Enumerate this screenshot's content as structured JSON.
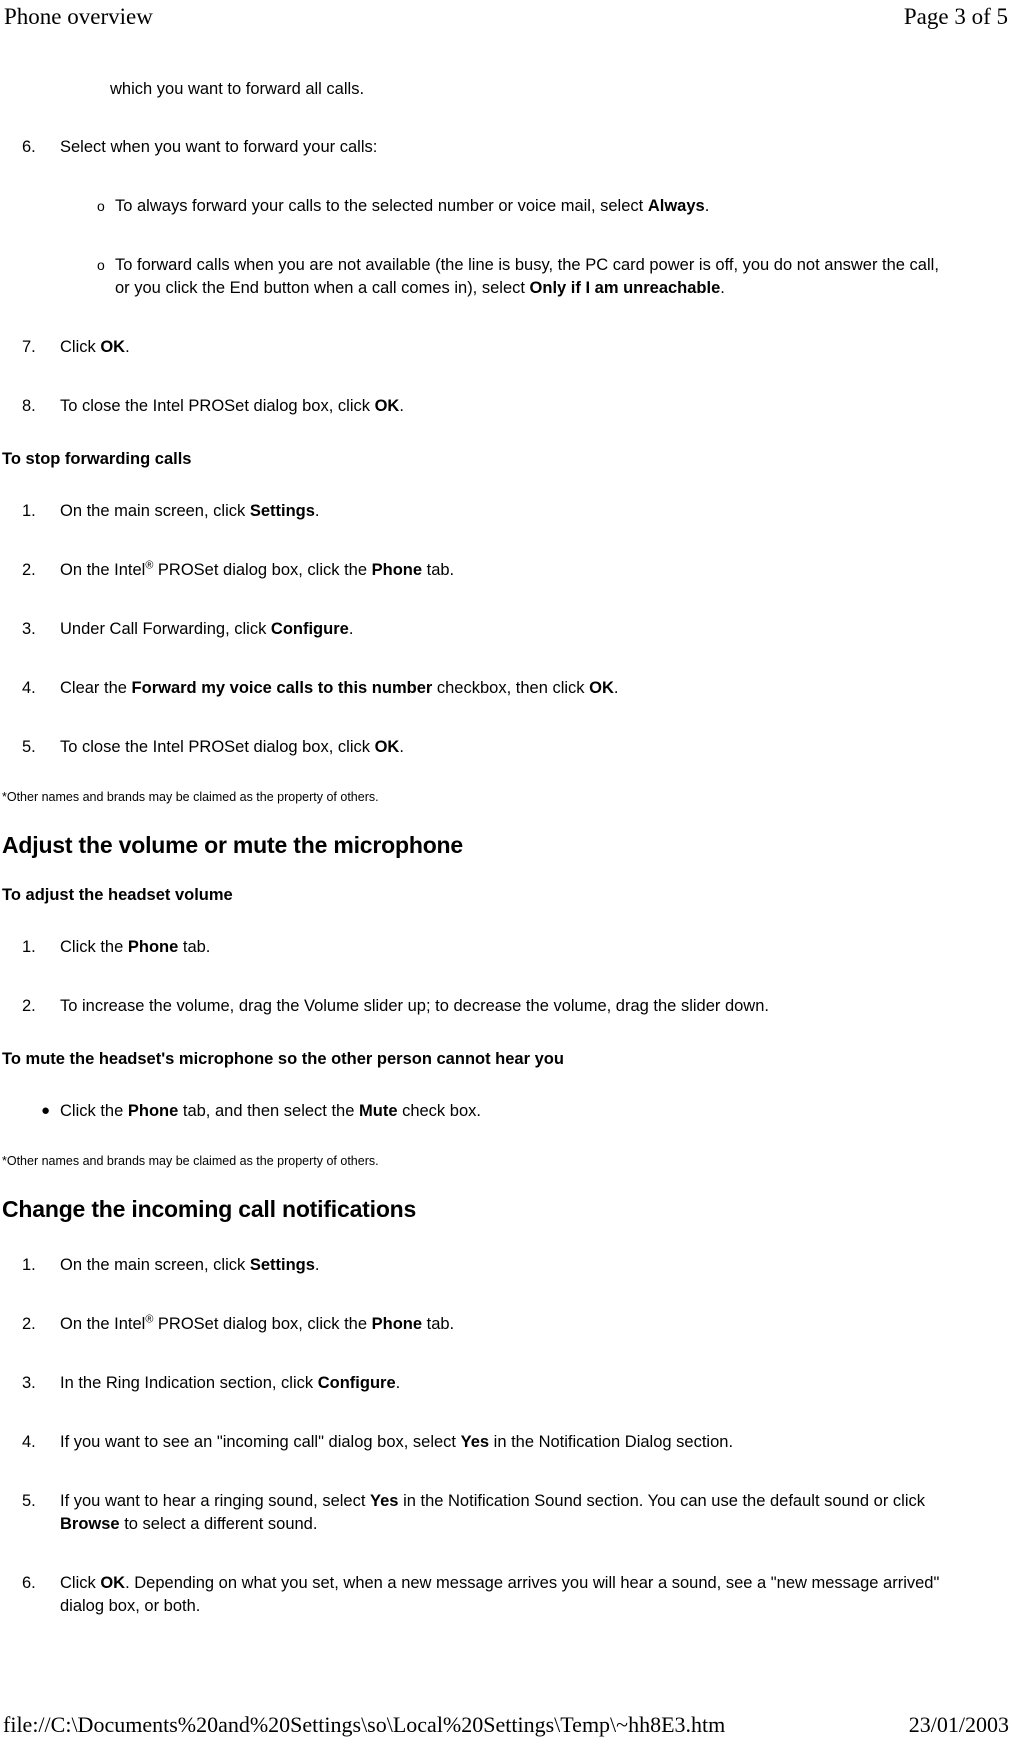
{
  "header": {
    "left": "Phone overview",
    "right": "Page 3 of 5"
  },
  "footer": {
    "path": "file://C:\\Documents%20and%20Settings\\so\\Local%20Settings\\Temp\\~hh8E3.htm",
    "date": "23/01/2003"
  },
  "content": {
    "continued_line": "which you want to forward all calls.",
    "item6": {
      "marker": "6.",
      "text": "Select when you want to forward your calls:"
    },
    "sub_a": {
      "marker": "o",
      "pre": "To always forward your calls to the selected number or voice mail, select ",
      "bold": "Always",
      "post": "."
    },
    "sub_b": {
      "marker": "o",
      "pre": "To forward calls when you are not available (the line is busy, the PC card power is off, you do not answer the call, or you click the End button when a call comes in), select ",
      "bold": "Only if I am unreachable",
      "post": "."
    },
    "item7": {
      "marker": "7.",
      "pre": "Click ",
      "bold": "OK",
      "post": "."
    },
    "item8": {
      "marker": "8.",
      "pre": "To close the Intel PROSet dialog box, click ",
      "bold": "OK",
      "post": "."
    },
    "stop_forwarding": {
      "heading": "To stop forwarding calls",
      "steps": [
        {
          "marker": "1.",
          "pre": "On the main screen, click ",
          "bold": "Settings",
          "post": "."
        },
        {
          "marker": "2.",
          "pre": "On the Intel",
          "sup": "®",
          "mid": " PROSet dialog box, click the ",
          "bold": "Phone",
          "post": " tab."
        },
        {
          "marker": "3.",
          "pre": "Under Call Forwarding, click ",
          "bold": "Configure",
          "post": "."
        },
        {
          "marker": "4.",
          "pre": "Clear the ",
          "bold": "Forward my voice calls to this number",
          "mid": " checkbox, then click ",
          "bold2": "OK",
          "post": "."
        },
        {
          "marker": "5.",
          "pre": "To close the Intel PROSet dialog box, click ",
          "bold": "OK",
          "post": "."
        }
      ]
    },
    "footnote1": "*Other names and brands may be claimed as the property of others.",
    "volume_section": {
      "heading": "Adjust the volume or mute the microphone",
      "sub1": "To adjust the headset volume",
      "steps": [
        {
          "marker": "1.",
          "pre": "Click the ",
          "bold": "Phone",
          "post": " tab."
        },
        {
          "marker": "2.",
          "pre": "To increase the volume, drag the Volume slider up; to decrease the volume, drag the slider down.",
          "bold": "",
          "post": ""
        }
      ],
      "sub2": "To mute the headset's microphone so the other person cannot hear you",
      "bullet": {
        "marker": "●",
        "pre": "Click the ",
        "bold": "Phone",
        "mid": " tab, and then select the ",
        "bold2": "Mute",
        "post": " check box."
      }
    },
    "footnote2": "*Other names and brands may be claimed as the property of others.",
    "notifications_section": {
      "heading": "Change the incoming call notifications",
      "steps": [
        {
          "marker": "1.",
          "pre": "On the main screen, click ",
          "bold": "Settings",
          "post": "."
        },
        {
          "marker": "2.",
          "pre": "On the Intel",
          "sup": "®",
          "mid": " PROSet dialog box, click the ",
          "bold": "Phone",
          "post": " tab."
        },
        {
          "marker": "3.",
          "pre": "In the Ring Indication section, click ",
          "bold": "Configure",
          "post": "."
        },
        {
          "marker": "4.",
          "pre": "If you want to see an \"incoming call\" dialog box, select ",
          "bold": "Yes",
          "post": " in the Notification Dialog section."
        },
        {
          "marker": "5.",
          "pre": "If you want to hear a ringing sound, select ",
          "bold": "Yes",
          "mid": " in the Notification Sound section. You can use the default sound or click ",
          "bold2": "Browse",
          "post": " to select a different sound."
        },
        {
          "marker": "6.",
          "pre": "Click ",
          "bold": "OK",
          "post": ". Depending on what you set, when a new message arrives you will hear a sound, see a \"new message arrived\" dialog box, or both."
        }
      ]
    }
  }
}
